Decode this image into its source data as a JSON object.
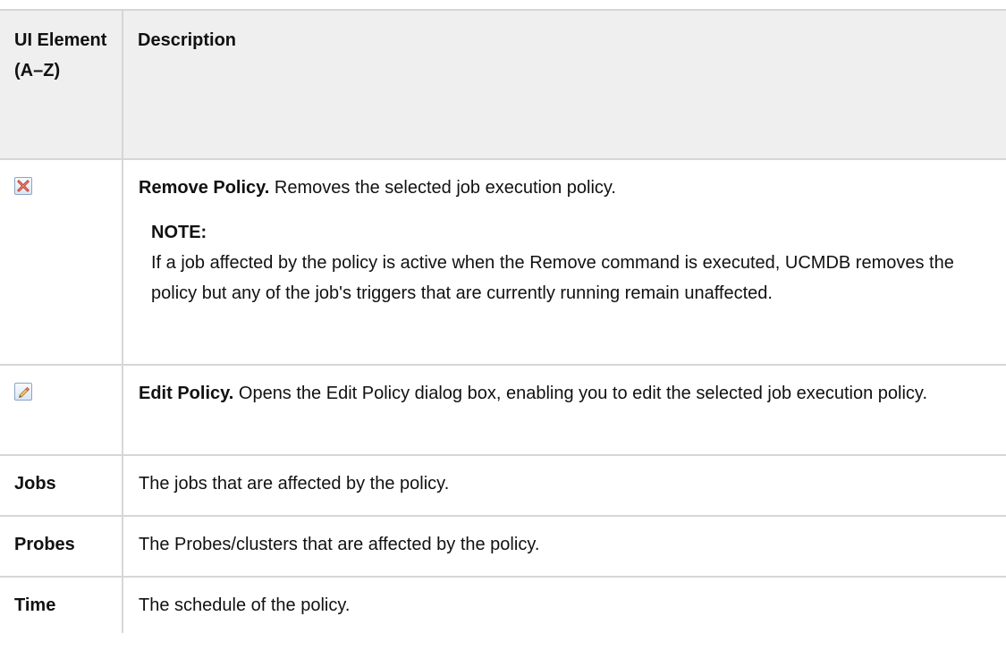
{
  "table": {
    "header": {
      "col1": "UI Element (A–Z)",
      "col2": "Description"
    },
    "rows": [
      {
        "icon": "remove-icon",
        "title": "Remove Policy.",
        "text": " Removes the selected job execution policy.",
        "note_label": "NOTE:",
        "note_text": "If a job affected by the policy is active when the Remove command is executed, UCMDB removes the policy but any of the job's triggers that are currently running remain unaffected."
      },
      {
        "icon": "edit-icon",
        "title": "Edit Policy.",
        "text": " Opens the Edit Policy dialog box, enabling you to edit the selected job execution policy."
      },
      {
        "element": "Jobs",
        "text": "The jobs that are affected by the policy."
      },
      {
        "element": "Probes",
        "text": "The Probes/clusters that are affected by the policy."
      },
      {
        "element": "Time",
        "text": "The schedule of the policy."
      }
    ]
  }
}
